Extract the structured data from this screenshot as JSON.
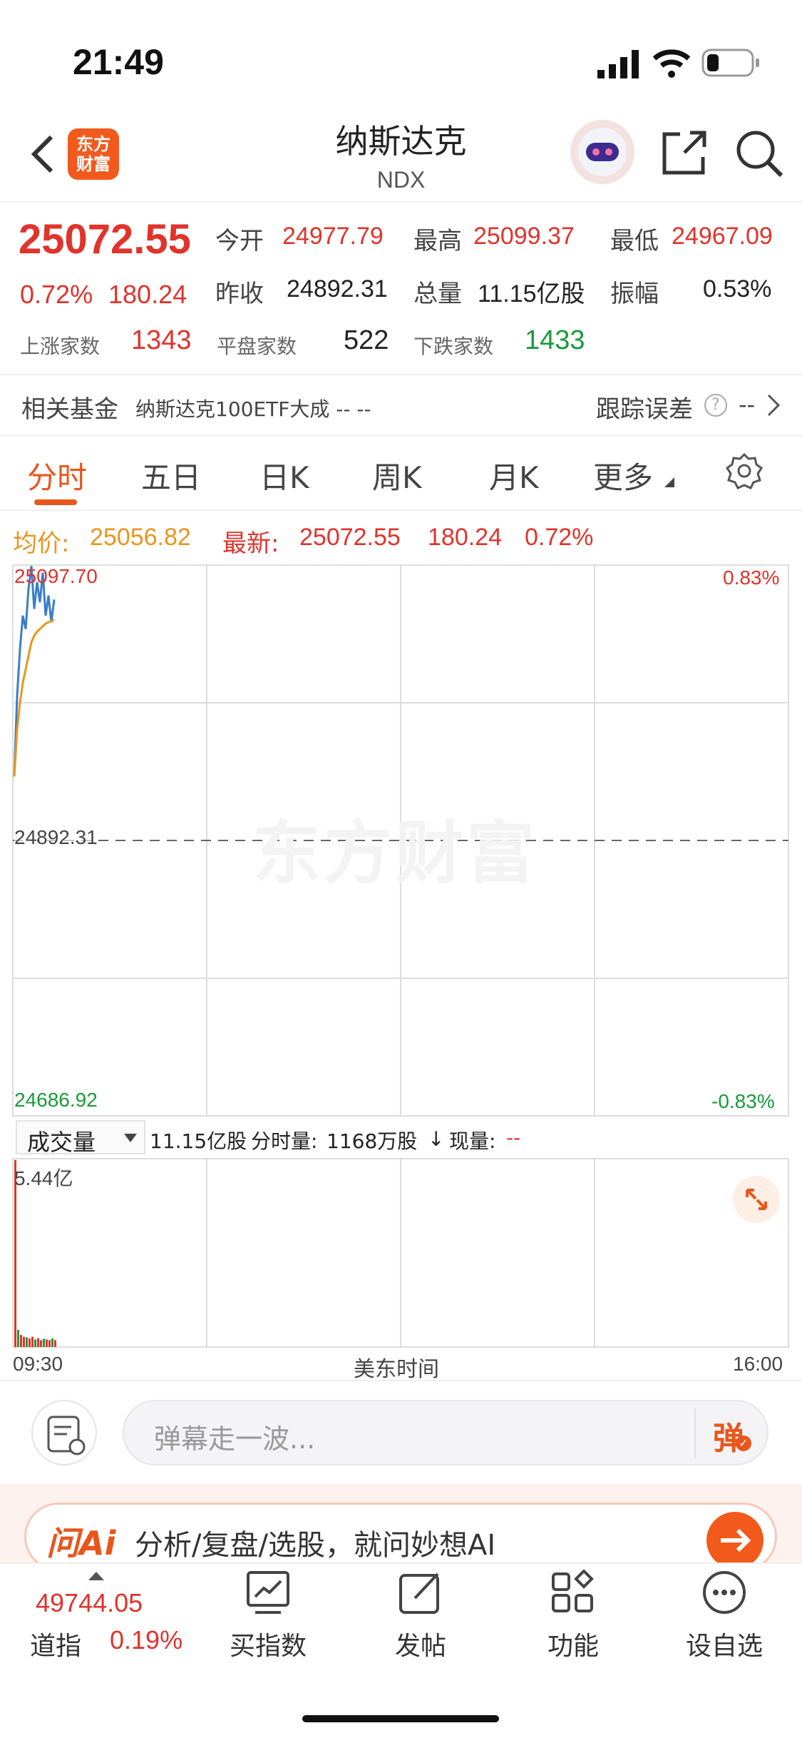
{
  "status": {
    "time": "21:49"
  },
  "header": {
    "title": "纳斯达克",
    "code": "NDX",
    "logo_line1": "东方",
    "logo_line2": "财富"
  },
  "quote": {
    "price": "25072.55",
    "change_pct": "0.72%",
    "change": "180.24",
    "open_label": "今开",
    "open": "24977.79",
    "high_label": "最高",
    "high": "25099.37",
    "low_label": "最低",
    "low": "24967.09",
    "prev_label": "昨收",
    "prev": "24892.31",
    "volume_label": "总量",
    "volume": "11.15亿股",
    "amplitude_label": "振幅",
    "amplitude": "0.53%",
    "up_label": "上涨家数",
    "up": "1343",
    "flat_label": "平盘家数",
    "flat": "522",
    "down_label": "下跌家数",
    "down": "1433"
  },
  "fund": {
    "label": "相关基金",
    "name": "纳斯达克100ETF大成 -- --",
    "tracking_label": "跟踪误差",
    "tracking_value": "--"
  },
  "tabs": [
    {
      "label": "分时"
    },
    {
      "label": "五日"
    },
    {
      "label": "日K"
    },
    {
      "label": "周K"
    },
    {
      "label": "月K"
    },
    {
      "label": "更多"
    }
  ],
  "summary": {
    "avg_label": "均价:",
    "avg": "25056.82",
    "latest_label": "最新:",
    "latest": "25072.55",
    "change": "180.24",
    "change_pct": "0.72%"
  },
  "chart_data": {
    "type": "line",
    "y_top_label": "25097.70",
    "y_mid_label": "24892.31",
    "y_bottom_label": "24686.92",
    "pct_top": "0.83%",
    "pct_bottom": "-0.83%",
    "watermark": "东方财富",
    "ylim": [
      24686.92,
      25097.7
    ],
    "series": [
      {
        "values": [
          24940,
          25000,
          25035,
          25060,
          25050,
          25080,
          25097,
          25065,
          25085,
          25070,
          25092,
          25060,
          25075,
          25055,
          25072
        ]
      },
      {
        "values": [
          24940,
          24975,
          24995,
          25010,
          25020,
          25030,
          25040,
          25045,
          25048,
          25050,
          25052,
          25054,
          25055,
          25056,
          25057
        ]
      }
    ],
    "volume": {
      "selector": "成交量",
      "total": "11.15亿股",
      "minute_label": "分时量:",
      "minute": "1168万股",
      "now_label": "现量:",
      "now": "--",
      "max_label": "5.44亿",
      "bars": [
        5.44,
        0.5,
        0.35,
        0.3,
        0.28,
        0.25,
        0.3,
        0.22,
        0.26,
        0.2,
        0.24,
        0.22,
        0.2,
        0.25,
        0.2
      ]
    },
    "x_start": "09:30",
    "x_mid": "美东时间",
    "x_end": "16:00"
  },
  "comment": {
    "placeholder": "弹幕走一波...",
    "danmu_label": "弹"
  },
  "ai_banner": {
    "brand": "问Ai",
    "text": "分析/复盘/选股，就问妙想AI"
  },
  "bottom_nav": {
    "index_value": "49744.05",
    "index_name": "道指",
    "index_pct": "0.19%",
    "items": [
      {
        "label": "买指数"
      },
      {
        "label": "发帖"
      },
      {
        "label": "功能"
      },
      {
        "label": "设自选"
      }
    ]
  },
  "colors": {
    "accent": "#e8561c",
    "up": "#e0332c",
    "down": "#1a9a3a",
    "avg_line": "#e8961e",
    "price_line": "#3a7dc9"
  }
}
